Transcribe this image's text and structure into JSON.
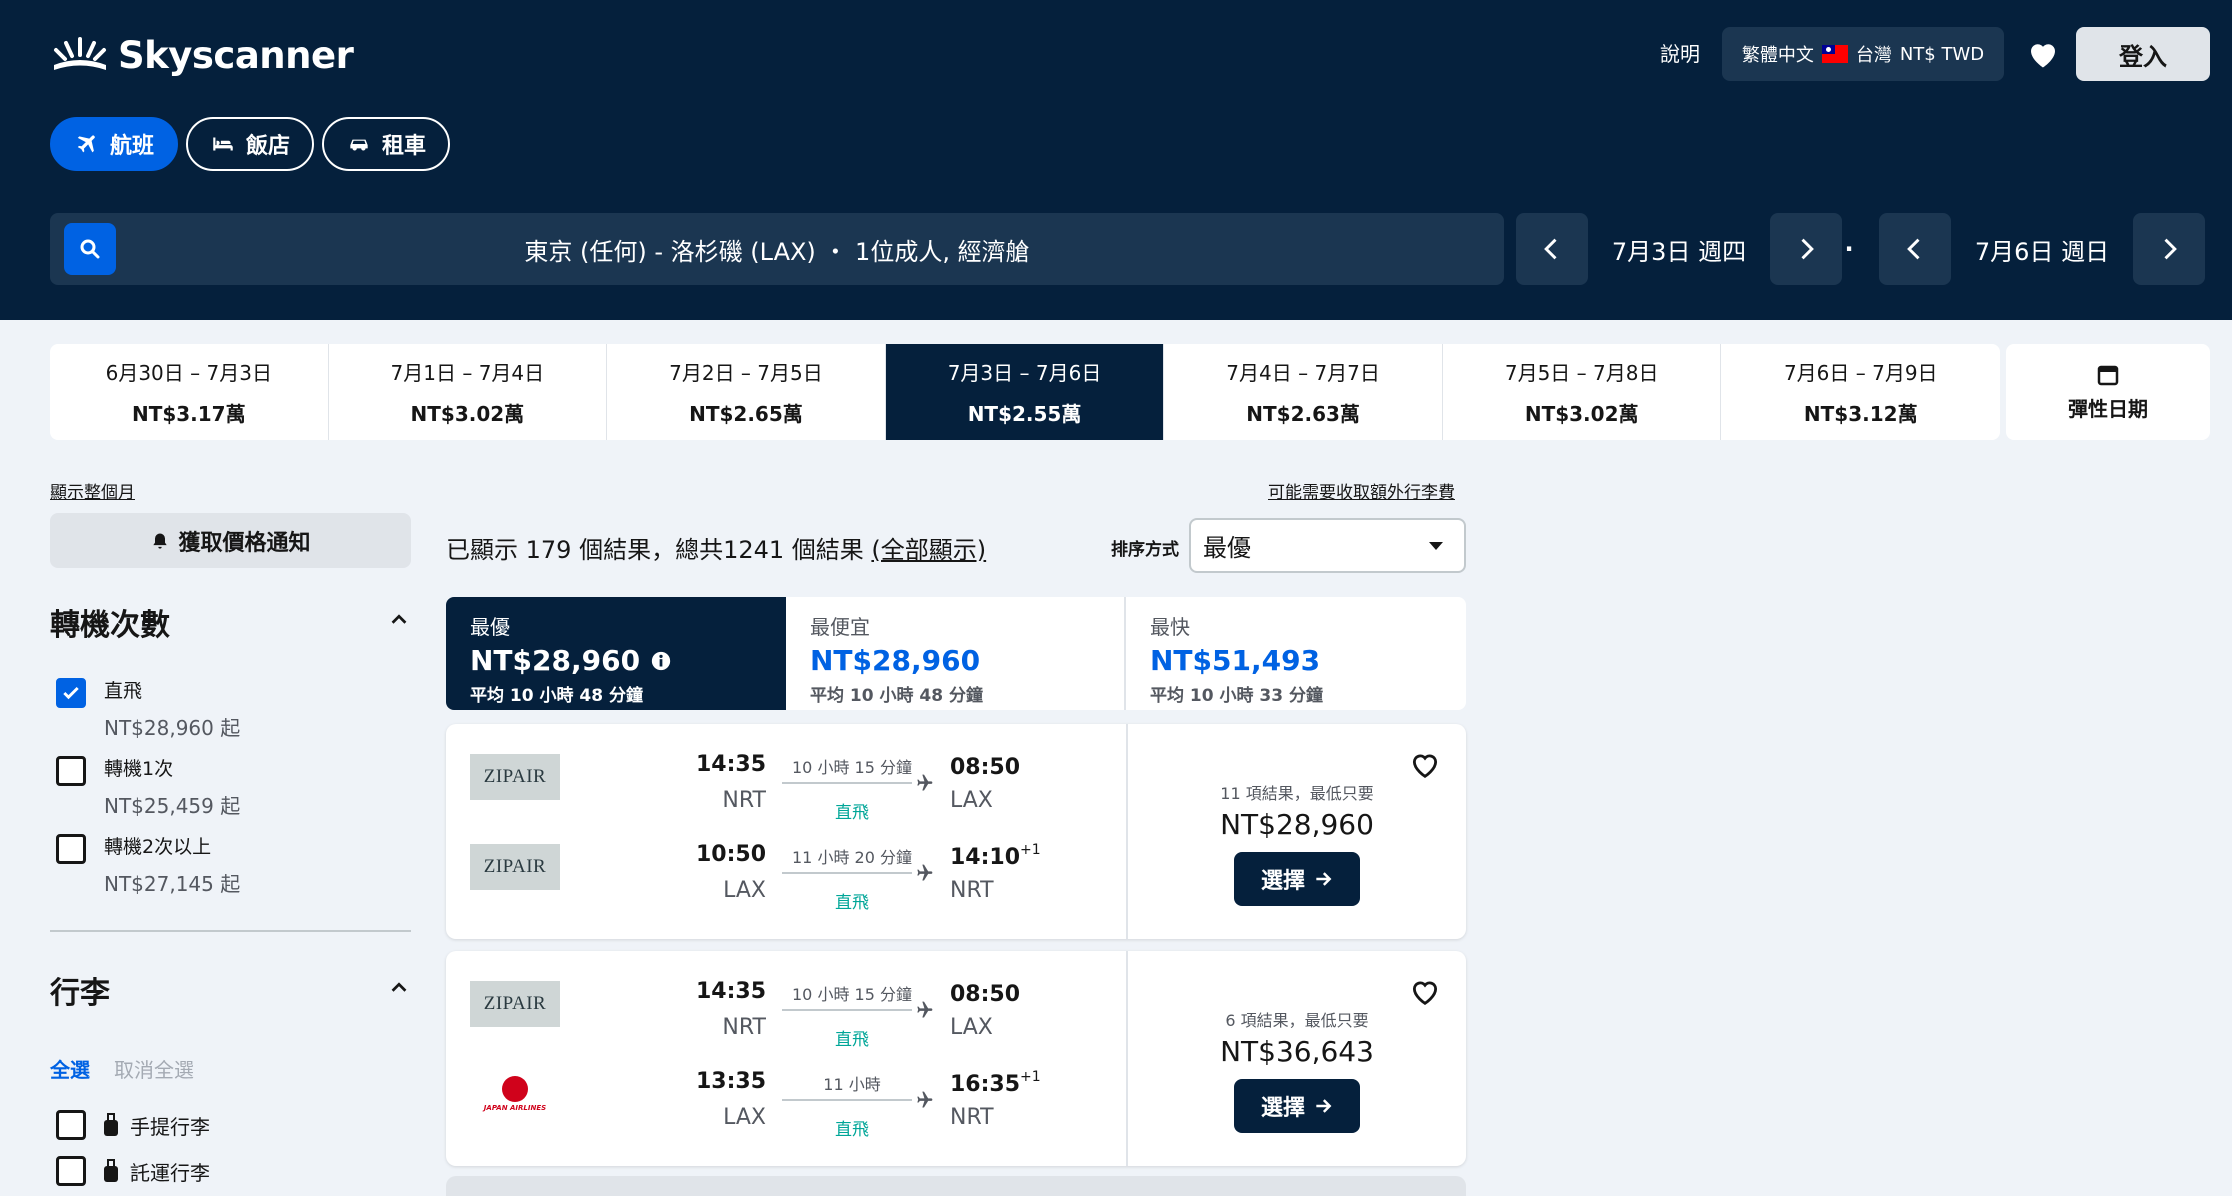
{
  "header": {
    "brand": "Skyscanner",
    "help": "說明",
    "language": "繁體中文",
    "region": "台灣",
    "currency": "NT$ TWD",
    "login": "登入"
  },
  "tabs": [
    {
      "label": "航班",
      "icon": "plane-icon",
      "active": true
    },
    {
      "label": "飯店",
      "icon": "bed-icon",
      "active": false
    },
    {
      "label": "租車",
      "icon": "car-icon",
      "active": false
    }
  ],
  "search": {
    "summary": "東京 (任何) - 洛杉磯 (LAX) ・ 1位成人, 經濟艙",
    "depart_date": "7月3日 週四",
    "return_date": "7月6日 週日"
  },
  "date_strip": [
    {
      "range": "6月30日 – 7月3日",
      "price": "NT$3.17萬",
      "active": false
    },
    {
      "range": "7月1日 – 7月4日",
      "price": "NT$3.02萬",
      "active": false
    },
    {
      "range": "7月2日 – 7月5日",
      "price": "NT$2.65萬",
      "active": false
    },
    {
      "range": "7月3日 – 7月6日",
      "price": "NT$2.55萬",
      "active": true
    },
    {
      "range": "7月4日 – 7月7日",
      "price": "NT$2.63萬",
      "active": false
    },
    {
      "range": "7月5日 – 7月8日",
      "price": "NT$3.02萬",
      "active": false
    },
    {
      "range": "7月6日 – 7月9日",
      "price": "NT$3.12萬",
      "active": false
    }
  ],
  "flex_dates": "彈性日期",
  "sidebar": {
    "show_month": "顯示整個月",
    "price_alert": "獲取價格通知",
    "stops_title": "轉機次數",
    "stops": [
      {
        "label": "直飛",
        "price": "NT$28,960 起",
        "checked": true
      },
      {
        "label": "轉機1次",
        "price": "NT$25,459 起",
        "checked": false
      },
      {
        "label": "轉機2次以上",
        "price": "NT$27,145 起",
        "checked": false
      }
    ],
    "bags_title": "行李",
    "select_all": "全選",
    "clear_all": "取消全選",
    "bags": [
      {
        "label": "手提行李",
        "checked": false
      },
      {
        "label": "託運行李",
        "checked": false
      }
    ]
  },
  "results": {
    "baggage_note": "可能需要收取額外行李費",
    "count_prefix": "已顯示 179 個結果，總共1241 個結果 ",
    "show_all": "(全部顯示)",
    "sort_label": "排序方式",
    "sort_value": "最優",
    "sort_tabs": [
      {
        "label": "最優",
        "price": "NT$28,960",
        "duration": "平均 10 小時 48 分鐘",
        "active": true
      },
      {
        "label": "最便宜",
        "price": "NT$28,960",
        "duration": "平均 10 小時 48 分鐘",
        "active": false
      },
      {
        "label": "最快",
        "price": "NT$51,493",
        "duration": "平均 10 小時 33 分鐘",
        "active": false
      }
    ],
    "cards": [
      {
        "legs": [
          {
            "airline": "ZIPAIR",
            "logo": "zipair",
            "dep_time": "14:35",
            "dep_airport": "NRT",
            "duration": "10 小時 15 分鐘",
            "stops": "直飛",
            "arr_time": "08:50",
            "arr_offset": "",
            "arr_airport": "LAX"
          },
          {
            "airline": "ZIPAIR",
            "logo": "zipair",
            "dep_time": "10:50",
            "dep_airport": "LAX",
            "duration": "11 小時 20 分鐘",
            "stops": "直飛",
            "arr_time": "14:10",
            "arr_offset": "+1",
            "arr_airport": "NRT"
          }
        ],
        "deals": "11 項結果，最低只要",
        "price": "NT$28,960",
        "select": "選擇"
      },
      {
        "legs": [
          {
            "airline": "ZIPAIR",
            "logo": "zipair",
            "dep_time": "14:35",
            "dep_airport": "NRT",
            "duration": "10 小時 15 分鐘",
            "stops": "直飛",
            "arr_time": "08:50",
            "arr_offset": "",
            "arr_airport": "LAX"
          },
          {
            "airline": "JAPAN AIRLINES",
            "logo": "jal",
            "dep_time": "13:35",
            "dep_airport": "LAX",
            "duration": "11 小時",
            "stops": "直飛",
            "arr_time": "16:35",
            "arr_offset": "+1",
            "arr_airport": "NRT"
          }
        ],
        "deals": "6 項結果，最低只要",
        "price": "NT$36,643",
        "select": "選擇"
      }
    ]
  },
  "colors": {
    "navy": "#05203c",
    "blue": "#0062e3",
    "teal": "#00a698"
  }
}
